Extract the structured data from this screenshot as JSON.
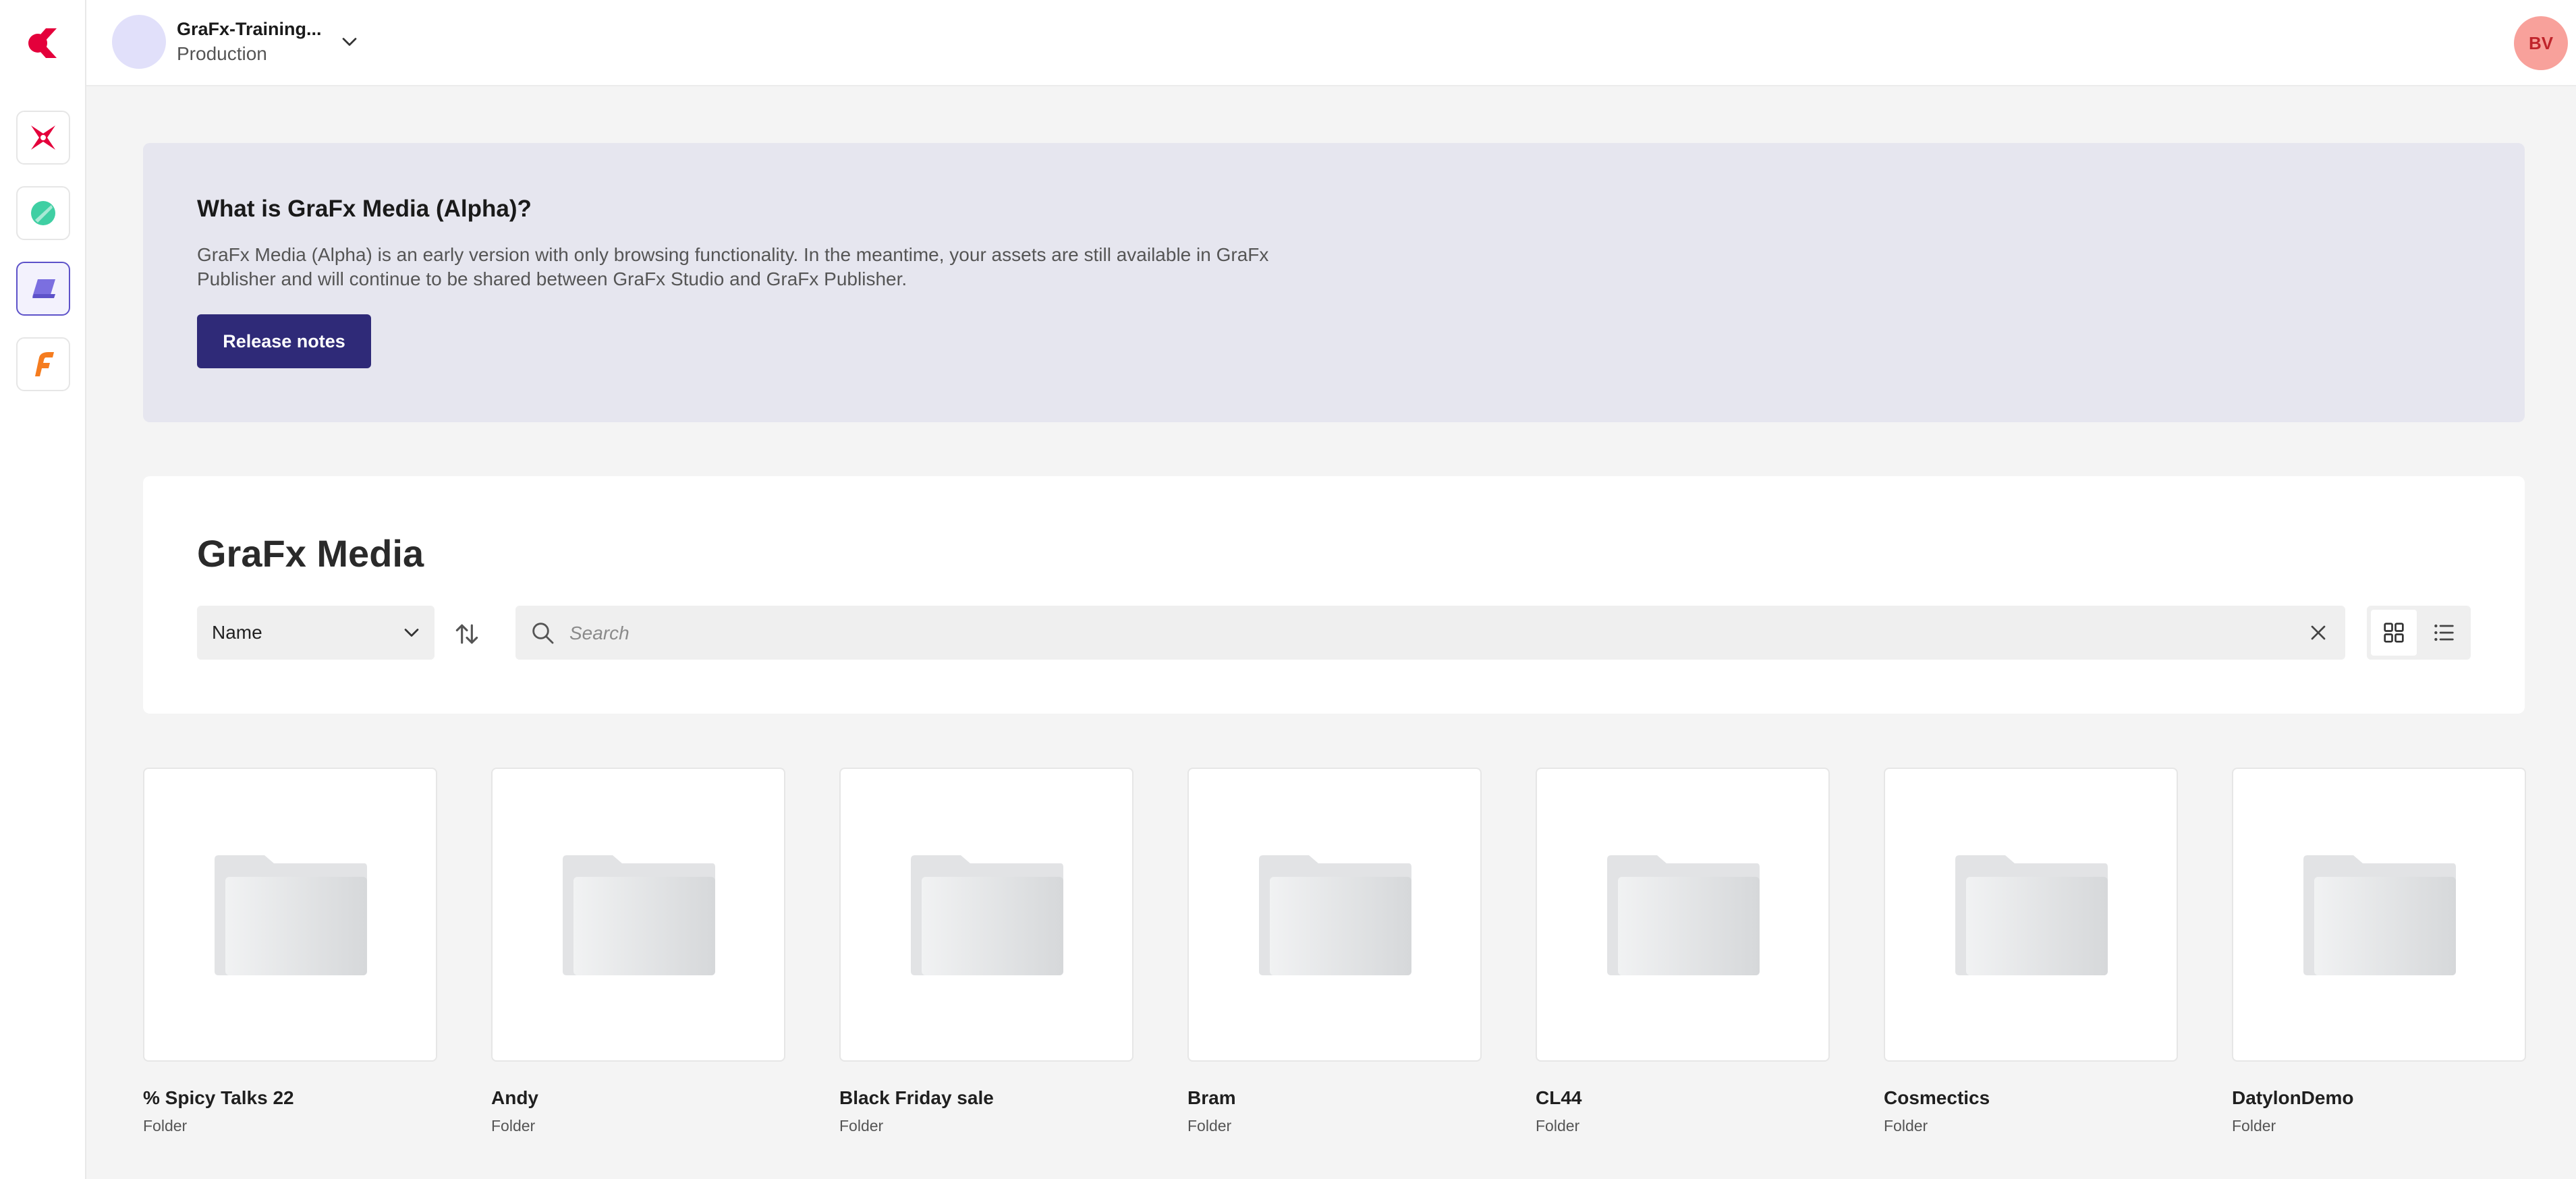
{
  "environment": {
    "name": "GraFx-Training...",
    "type": "Production"
  },
  "user": {
    "initials": "BV"
  },
  "rail": {
    "items": [
      {
        "icon": "grafx-studio-icon"
      },
      {
        "icon": "grafx-publisher-icon"
      },
      {
        "icon": "grafx-media-icon",
        "active": true
      },
      {
        "icon": "grafx-fonts-icon"
      }
    ]
  },
  "banner": {
    "title": "What is GraFx Media (Alpha)?",
    "text": "GraFx Media (Alpha) is an early version with only browsing functionality. In the meantime, your assets are still available in GraFx Publisher and will continue to be shared between GraFx Studio and GraFx Publisher.",
    "button": "Release notes"
  },
  "media": {
    "title": "GraFx Media",
    "sort_value": "Name",
    "search_placeholder": "Search",
    "view_mode": "grid"
  },
  "folders": [
    {
      "name": "% Spicy Talks 22",
      "type": "Folder"
    },
    {
      "name": "Andy",
      "type": "Folder"
    },
    {
      "name": "Black Friday sale",
      "type": "Folder"
    },
    {
      "name": "Bram",
      "type": "Folder"
    },
    {
      "name": "CL44",
      "type": "Folder"
    },
    {
      "name": "Cosmectics",
      "type": "Folder"
    },
    {
      "name": "DatylonDemo",
      "type": "Folder"
    }
  ],
  "colors": {
    "brand": "#e4003b",
    "primary_button": "#2f2a78",
    "active_rail": "#5d52c9",
    "avatar": "#f8a19b"
  }
}
